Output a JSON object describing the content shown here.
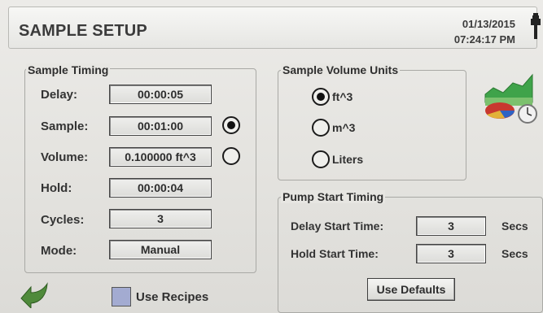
{
  "header": {
    "title": "SAMPLE SETUP",
    "date": "01/13/2015",
    "time": "07:24:17 PM",
    "power_icon": "plug-icon"
  },
  "sample_timing": {
    "label": "Sample Timing",
    "rows": [
      {
        "label": "Delay:",
        "value": "00:00:05"
      },
      {
        "label": "Sample:",
        "value": "00:01:00"
      },
      {
        "label": "Volume:",
        "value": "0.100000 ft^3"
      },
      {
        "label": "Hold:",
        "value": "00:00:04"
      },
      {
        "label": "Cycles:",
        "value": "3"
      },
      {
        "label": "Mode:",
        "value": "Manual"
      }
    ],
    "selected_mode": "sample"
  },
  "sample_volume_units": {
    "label": "Sample Volume Units",
    "options": [
      "ft^3",
      "m^3",
      "Liters"
    ],
    "selected": "ft^3"
  },
  "pump_start_timing": {
    "label": "Pump Start Timing",
    "delay_label": "Delay Start Time:",
    "delay_value": "3",
    "hold_label": "Hold Start Time:",
    "hold_value": "3",
    "unit": "Secs",
    "defaults_button": "Use Defaults"
  },
  "footer": {
    "use_recipes_label": "Use Recipes",
    "use_recipes_checked": false,
    "back_icon": "back-arrow-icon"
  },
  "colors": {
    "checkbox": "#a3abd1",
    "arrow": "#4f8a3b"
  }
}
